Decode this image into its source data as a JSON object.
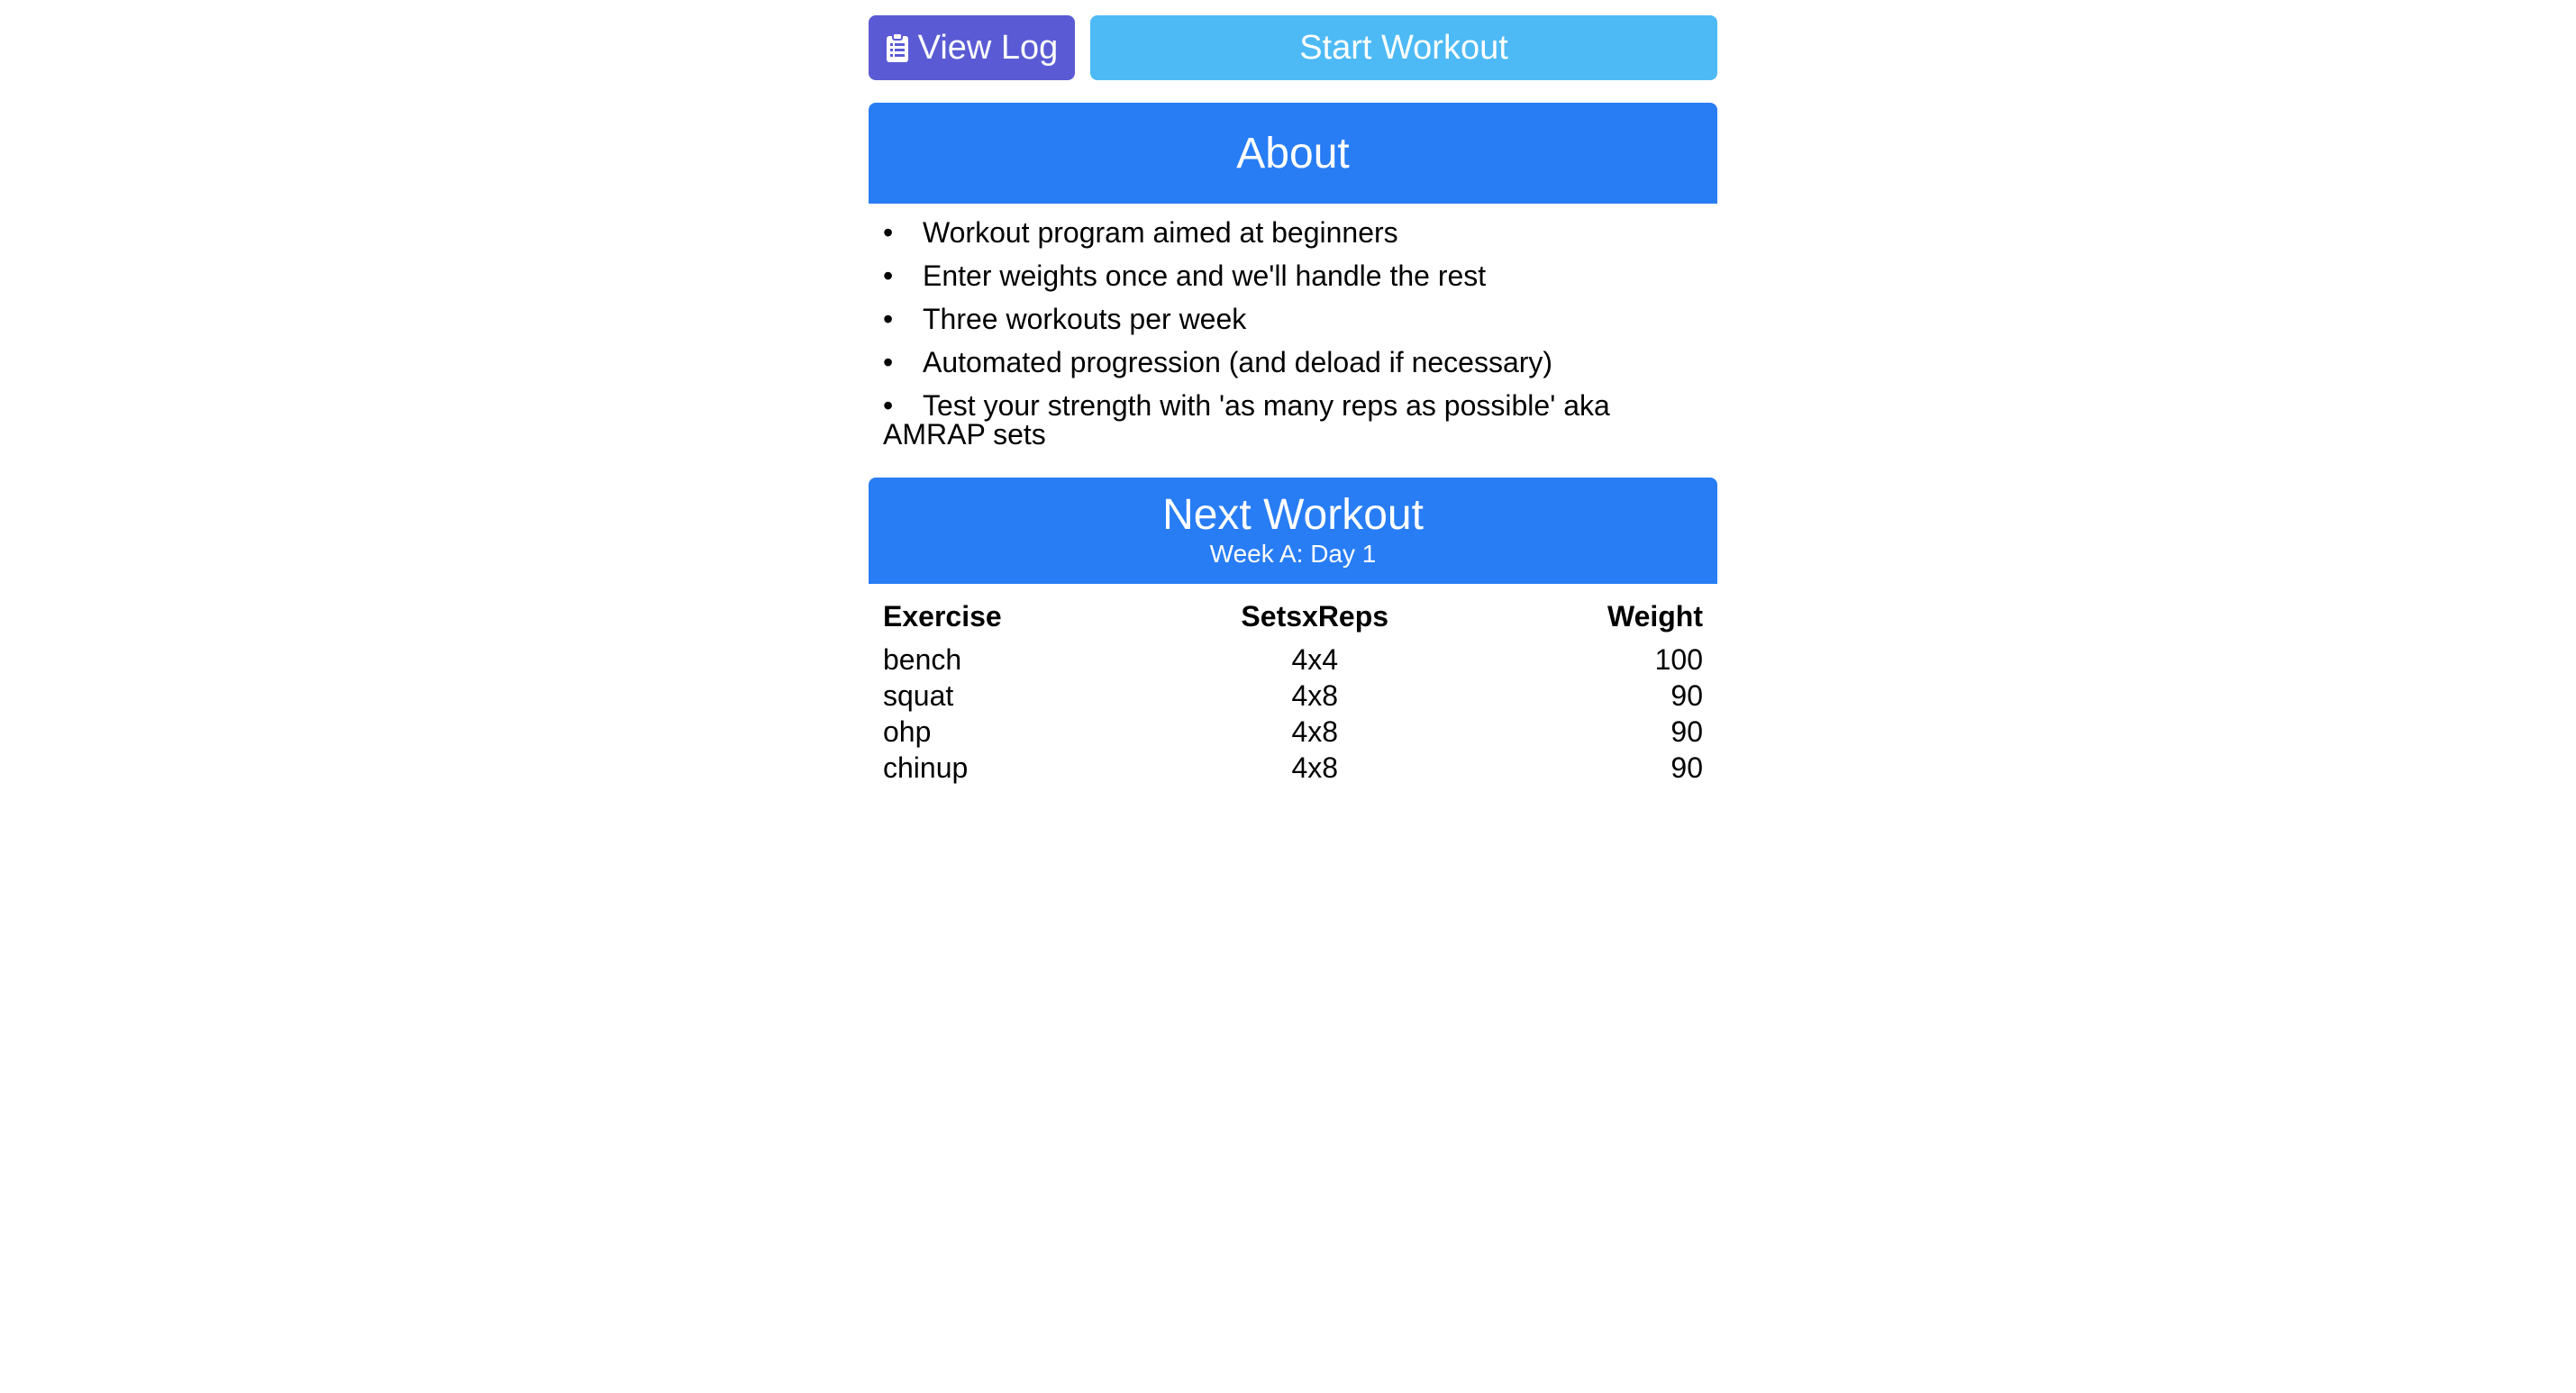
{
  "toolbar": {
    "view_log_label": "View Log",
    "view_log_icon": "clipboard-list-icon",
    "start_workout_label": "Start Workout",
    "colors": {
      "view_log_bg": "#5a5bd4",
      "start_workout_bg": "#4dbaf6",
      "header_bg": "#287df5"
    }
  },
  "about": {
    "title": "About",
    "items": [
      "Workout program aimed at beginners",
      "Enter weights once and we'll handle the rest",
      "Three workouts per week",
      "Automated progression (and deload if necessary)",
      "Test your strength with 'as many reps as possible' aka AMRAP sets"
    ]
  },
  "next_workout": {
    "title": "Next Workout",
    "subtitle": "Week A: Day 1",
    "columns": [
      "Exercise",
      "SetsxReps",
      "Weight"
    ],
    "rows": [
      {
        "exercise": "bench",
        "sets_reps": "4x4",
        "weight": "100"
      },
      {
        "exercise": "squat",
        "sets_reps": "4x8",
        "weight": "90"
      },
      {
        "exercise": "ohp",
        "sets_reps": "4x8",
        "weight": "90"
      },
      {
        "exercise": "chinup",
        "sets_reps": "4x8",
        "weight": "90"
      }
    ]
  }
}
